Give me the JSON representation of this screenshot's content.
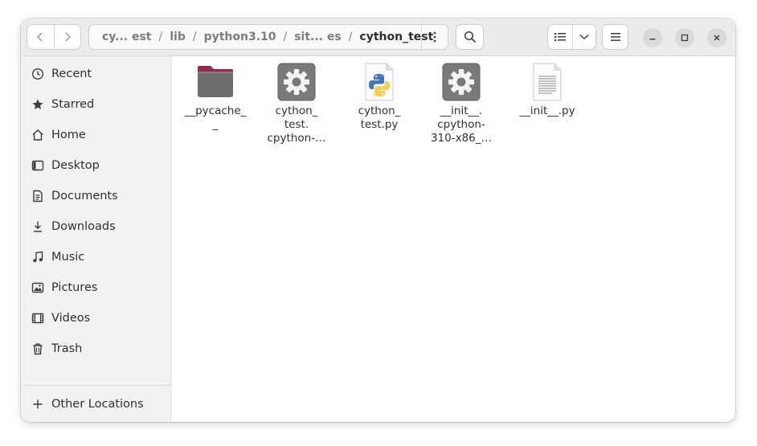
{
  "breadcrumb": {
    "parts": [
      "cy... est",
      "lib",
      "python3.10",
      "sit... es",
      "cython_test"
    ],
    "separator": "/"
  },
  "sidebar": {
    "items": [
      {
        "label": "Recent",
        "icon": "clock-icon"
      },
      {
        "label": "Starred",
        "icon": "star-icon"
      },
      {
        "label": "Home",
        "icon": "home-icon"
      },
      {
        "label": "Desktop",
        "icon": "desktop-icon"
      },
      {
        "label": "Documents",
        "icon": "document-icon"
      },
      {
        "label": "Downloads",
        "icon": "download-icon"
      },
      {
        "label": "Music",
        "icon": "music-icon"
      },
      {
        "label": "Pictures",
        "icon": "picture-icon"
      },
      {
        "label": "Videos",
        "icon": "video-icon"
      },
      {
        "label": "Trash",
        "icon": "trash-icon"
      }
    ],
    "other_locations": {
      "label": "Other Locations",
      "icon": "plus-icon"
    }
  },
  "files": [
    {
      "name_lines": [
        "__pycache_",
        "_"
      ],
      "type": "folder"
    },
    {
      "name_lines": [
        "cython_",
        "test.",
        "cpython-…"
      ],
      "type": "shared-library"
    },
    {
      "name_lines": [
        "cython_",
        "test.py"
      ],
      "type": "python-script"
    },
    {
      "name_lines": [
        "__init__.",
        "cpython-",
        "310-x86_…"
      ],
      "type": "shared-library"
    },
    {
      "name_lines": [
        "__init__.py"
      ],
      "type": "text-file"
    }
  ],
  "colors": {
    "folder": "#8d2c4d",
    "folder_body": "#6e6e6e",
    "gear_bg": "#7a7a7a"
  }
}
